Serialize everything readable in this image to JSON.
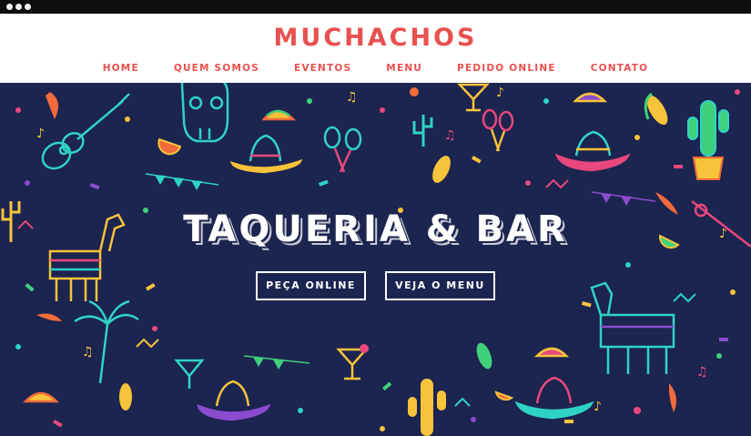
{
  "brand": {
    "name": "MUCHACHOS",
    "color": "#e8514f"
  },
  "nav": {
    "items": [
      {
        "label": "HOME"
      },
      {
        "label": "QUEM SOMOS"
      },
      {
        "label": "EVENTOS"
      },
      {
        "label": "MENU"
      },
      {
        "label": "PEDIDO ONLINE"
      },
      {
        "label": "CONTATO"
      }
    ]
  },
  "hero": {
    "title": "TAQUERIA & BAR",
    "background": "#1c2450",
    "buttons": [
      {
        "label": "PEÇA ONLINE"
      },
      {
        "label": "VEJA O MENU"
      }
    ],
    "decorations": [
      "guitar-icon",
      "sombrero-icon",
      "cactus-icon",
      "pinata-icon",
      "taco-icon",
      "maracas-icon",
      "chili-pepper-icon",
      "margarita-icon",
      "corn-icon",
      "skull-icon",
      "palm-tree-icon",
      "lime-slice-icon"
    ]
  },
  "palette": {
    "teal": "#2fd3c6",
    "yellow": "#f7c33a",
    "pink": "#e8487c",
    "purple": "#8b4ccf",
    "orange": "#f26b3a",
    "green": "#3fd17a"
  }
}
